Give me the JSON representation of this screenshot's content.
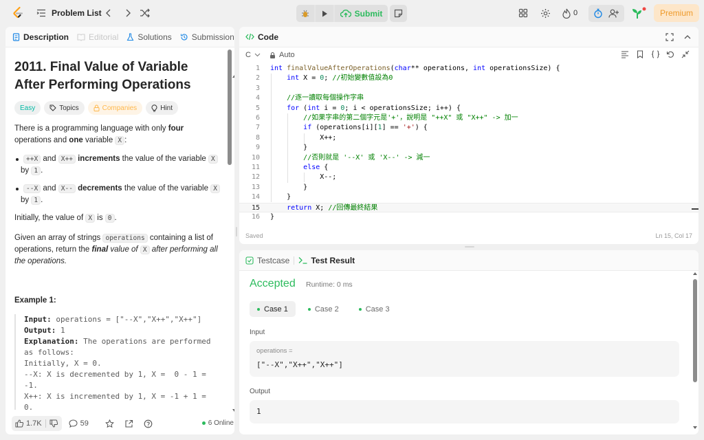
{
  "topbar": {
    "problem_list": "Problem List",
    "submit": "Submit",
    "streak_count": "0",
    "premium": "Premium"
  },
  "description": {
    "tabs": {
      "description": "Description",
      "editorial": "Editorial",
      "solutions": "Solutions",
      "submissions": "Submissions"
    },
    "title": "2011. Final Value of Variable After Performing Operations",
    "badges": {
      "difficulty": "Easy",
      "topics": "Topics",
      "companies": "Companies",
      "hint": "Hint"
    },
    "intro": {
      "a": "There is a programming language with only ",
      "b": "four",
      "c": " operations and ",
      "d": "one",
      "e": " variable ",
      "f": "X",
      "g": ":"
    },
    "bullets": [
      {
        "op1": "++X",
        "and": " and ",
        "op2": "X++",
        "verb": " increments",
        "rest": " the value of the variable ",
        "var": "X",
        "by": " by ",
        "num": "1",
        "end": "."
      },
      {
        "op1": "--X",
        "and": " and ",
        "op2": "X--",
        "verb": " decrements",
        "rest": " the value of the variable ",
        "var": "X",
        "by": " by ",
        "num": "1",
        "end": "."
      }
    ],
    "initially": {
      "a": "Initially, the value of ",
      "b": "X",
      "c": " is ",
      "d": "0",
      "e": "."
    },
    "given": {
      "a": "Given an array of strings ",
      "b": "operations",
      "c": " containing a list of operations, return the ",
      "d": "final",
      "e": " value of ",
      "f": "X",
      "g": " after performing all the operations."
    },
    "example_title": "Example 1:",
    "example": {
      "input_label": "Input:",
      "input_value": " operations = [\"--X\",\"X++\",\"X++\"]",
      "output_label": "Output:",
      "output_value": " 1",
      "explanation_label": "Explanation:",
      "explanation_lines": [
        " The operations are performed",
        "as follows:",
        "Initially, X = 0.",
        "--X: X is decremented by 1, X =  0 - 1 =",
        "-1.",
        "X++: X is incremented by 1, X = -1 + 1 =",
        "0."
      ]
    },
    "footer": {
      "likes": "1.7K",
      "comments": "59",
      "online": "6 Online"
    }
  },
  "code": {
    "tab": "Code",
    "language": "C",
    "mode": "Auto",
    "status": "Saved",
    "cursor": "Ln 15, Col 17",
    "current_line": 15,
    "lines": [
      "int finalValueAfterOperations(char** operations, int operationsSize) {",
      "    int X = 0; //初始變數值設為0",
      "",
      "    //逐一讀取每個操作字串",
      "    for (int i = 0; i < operationsSize; i++) {",
      "        //如果字串的第二個字元是'+'，說明是 \"++X\" 或 \"X++\" -> 加一",
      "        if (operations[i][1] == '+') {",
      "            X++;",
      "        }",
      "        //否則就是 '--X' 或 'X--' -> 減一",
      "        else {",
      "            X--;",
      "        }",
      "    }",
      "    return X; //回傳最終結果",
      "}"
    ]
  },
  "tests": {
    "tab_testcase": "Testcase",
    "tab_result": "Test Result",
    "status": "Accepted",
    "runtime": "Runtime: 0 ms",
    "cases": [
      "Case 1",
      "Case 2",
      "Case 3"
    ],
    "input_label": "Input",
    "input_name": "operations =",
    "input_value": "[\"--X\",\"X++\",\"X++\"]",
    "output_label": "Output",
    "output_value": "1"
  },
  "colors": {
    "accepted": "#2cbb5d",
    "easy": "#00b8a3",
    "premium": "#ee9a2a",
    "keyword": "#0000ff",
    "comment": "#008000"
  }
}
